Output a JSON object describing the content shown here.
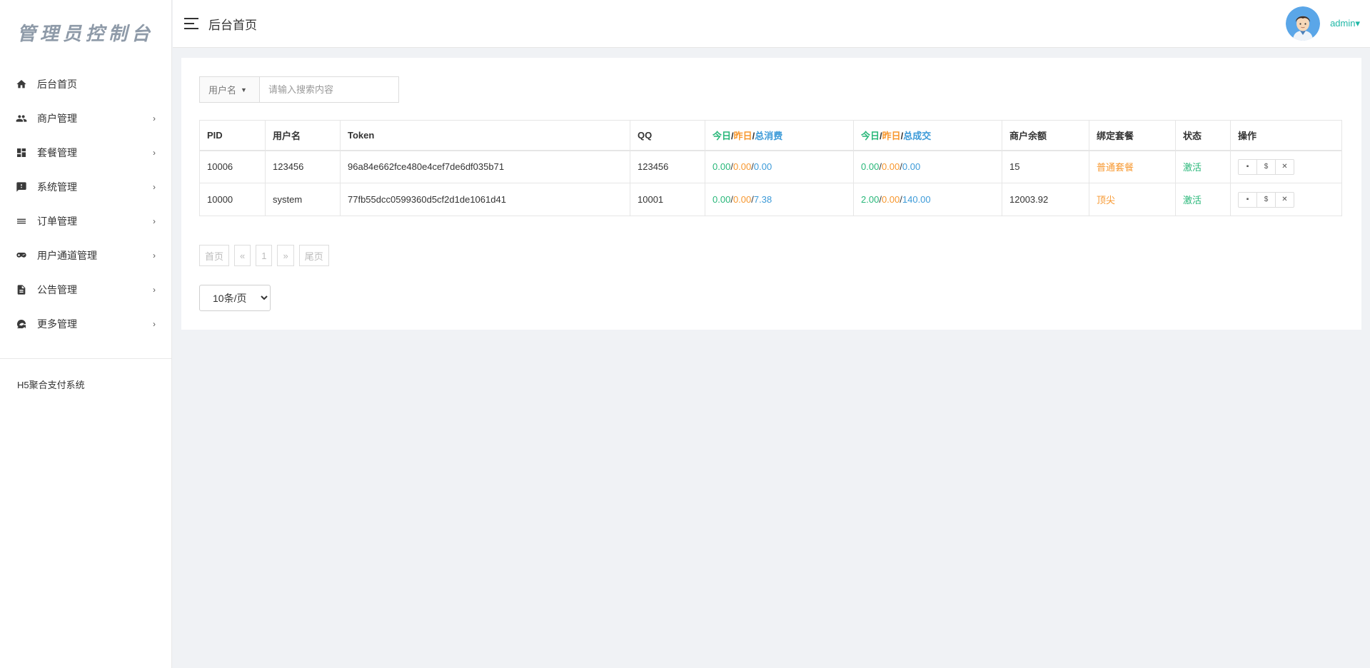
{
  "sidebar": {
    "logo": "管理员控制台",
    "items": [
      {
        "label": "后台首页",
        "icon": "home-icon",
        "chevron": ""
      },
      {
        "label": "商户管理",
        "icon": "users-icon",
        "chevron": "›"
      },
      {
        "label": "套餐管理",
        "icon": "dashboard-icon",
        "chevron": "›"
      },
      {
        "label": "系统管理",
        "icon": "feedback-icon",
        "chevron": "›"
      },
      {
        "label": "订单管理",
        "icon": "list-icon",
        "chevron": "›"
      },
      {
        "label": "用户通道管理",
        "icon": "gamepad-icon",
        "chevron": "›"
      },
      {
        "label": "公告管理",
        "icon": "document-icon",
        "chevron": "›"
      },
      {
        "label": "更多管理",
        "icon": "more-icon",
        "chevron": "›"
      }
    ],
    "footer": "H5聚合支付系统"
  },
  "header": {
    "title": "后台首页",
    "user": "admin▾"
  },
  "search": {
    "field": "用户名",
    "caret": "▼",
    "placeholder": "请输入搜索内容"
  },
  "table": {
    "headers": {
      "pid": "PID",
      "username": "用户名",
      "token": "Token",
      "qq": "QQ",
      "consume": {
        "today": "今日",
        "sep1": "/",
        "yesterday": "昨日",
        "sep2": "/",
        "total": "总消费"
      },
      "deal": {
        "today": "今日",
        "sep1": "/",
        "yesterday": "昨日",
        "sep2": "/",
        "total": "总成交"
      },
      "balance": "商户余额",
      "package": "绑定套餐",
      "status": "状态",
      "actions": "操作"
    },
    "rows": [
      {
        "pid": "10006",
        "username": "123456",
        "token": "96a84e662fce480e4cef7de6df035b71",
        "qq": "123456",
        "consume": {
          "today": "0.00",
          "sep1": "/",
          "yesterday": "0.00",
          "sep2": "/",
          "total": "0.00"
        },
        "deal": {
          "today": "0.00",
          "sep1": "/",
          "yesterday": "0.00",
          "sep2": "/",
          "total": "0.00"
        },
        "balance": "15",
        "package": "普通套餐",
        "status": "激活",
        "ops": {
          "msg": "▪",
          "money": "$",
          "del": "✕"
        }
      },
      {
        "pid": "10000",
        "username": "system",
        "token": "77fb55dcc0599360d5cf2d1de1061d41",
        "qq": "10001",
        "consume": {
          "today": "0.00",
          "sep1": "/",
          "yesterday": "0.00",
          "sep2": "/",
          "total": "7.38"
        },
        "deal": {
          "today": "2.00",
          "sep1": "/",
          "yesterday": "0.00",
          "sep2": "/",
          "total": "140.00"
        },
        "balance": "12003.92",
        "package": "顶尖",
        "status": "激活",
        "ops": {
          "msg": "▪",
          "money": "$",
          "del": "✕"
        }
      }
    ]
  },
  "pager": {
    "first": "首页",
    "prev": "«",
    "page": "1",
    "next": "»",
    "last": "尾页"
  },
  "per_page": {
    "selected": "10条/页"
  },
  "colors": {
    "green": "#28b779",
    "orange": "#f7972e",
    "blue": "#3c9ad8",
    "accent": "#1fb7a6"
  }
}
